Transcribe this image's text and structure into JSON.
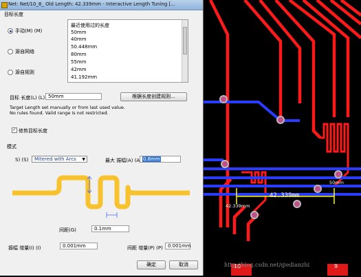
{
  "window": {
    "title": "Net: Net/10_8_  Old Length: 42.339mm - Interactive Length Tuning [..."
  },
  "target_length_group": {
    "title": "目标长度",
    "options": [
      {
        "label": "手动(M) (M)",
        "selected": true
      },
      {
        "label": "源自网络",
        "selected": false
      },
      {
        "label": "源自规则",
        "selected": false
      }
    ],
    "recent_header": "最近使用过的长度",
    "recent_items": [
      "50mm",
      "40mm",
      "50.448mm",
      "80mm",
      "55mm",
      "42mm",
      "41.192mm"
    ],
    "target_label": "目标 长度(L) (L)",
    "target_value": "50mm",
    "rule_button": "根据长度创建规则...",
    "info_line1": "Target Length set manually or from last used value.",
    "info_line2": "No rules found. Valid range is not restricted.",
    "keep_checkbox": "修剪目标长度",
    "keep_checked": true
  },
  "pattern_group": {
    "title": "模式",
    "style_label": "S) (S)",
    "style_value": "Mitered with Arcs",
    "max_amp_label": "最大 振幅(A) (A)",
    "max_amp_value": "0.8mm",
    "gap_label": "间距(G)",
    "gap_value": "0.1mm",
    "amp_inc_label": "振幅 增量(I) (I)",
    "amp_inc_value": "0.001mm",
    "gap_inc_label": "间距 增量(P) (P)",
    "gap_inc_value": "0.001mm"
  },
  "buttons": {
    "ok": "确定",
    "cancel": "取消"
  },
  "pcb": {
    "length_label": "42.339mm",
    "small_label_1": "50mm",
    "small_label_2": "42.339mm",
    "watermark": "http://blog.csdn.net/qiedianzhi",
    "pad_num_1": "10",
    "pad_num_2": "9",
    "colors": {
      "trace_red": "#ff1a1a",
      "trace_blue": "#2a3cff",
      "pad_gray": "#b8b8b8",
      "via_pink": "#c0508a",
      "highlight": "#ffff00"
    }
  }
}
